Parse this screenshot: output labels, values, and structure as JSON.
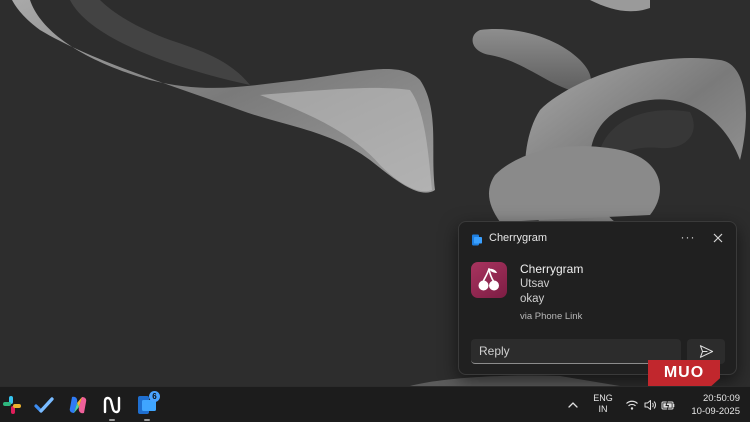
{
  "notification": {
    "app_name": "Cherrygram",
    "title": "Cherrygram",
    "sender": "Utsav",
    "message": "okay",
    "via": "via Phone Link",
    "more_label": "···",
    "reply_placeholder": "Reply",
    "reply_value": "",
    "icons": {
      "app": "phone-link-icon",
      "avatar": "cherry-icon",
      "close": "close-icon",
      "send": "send-icon"
    }
  },
  "watermark": {
    "text": "MUO"
  },
  "taskbar": {
    "pinned_apps": [
      {
        "name": "slack",
        "icon": "slack-icon"
      },
      {
        "name": "todo",
        "icon": "checkmark-icon"
      },
      {
        "name": "copilot",
        "icon": "copilot-icon"
      },
      {
        "name": "notion",
        "icon": "n-logo-icon"
      },
      {
        "name": "phone-link",
        "icon": "phone-link-icon",
        "badge": "6"
      }
    ],
    "tray": {
      "language_line1": "ENG",
      "language_line2": "IN",
      "icons": [
        "chevron-up-icon",
        "wifi-icon",
        "volume-icon",
        "battery-icon"
      ]
    },
    "clock": {
      "time": "20:50:09",
      "date": "10-09-2025"
    }
  },
  "colors": {
    "avatar": "#962a55",
    "badge": "#4aa3ff",
    "watermark": "#c1272d",
    "taskbar": "#1c1c1c",
    "desktop": "#2d2d2d"
  }
}
